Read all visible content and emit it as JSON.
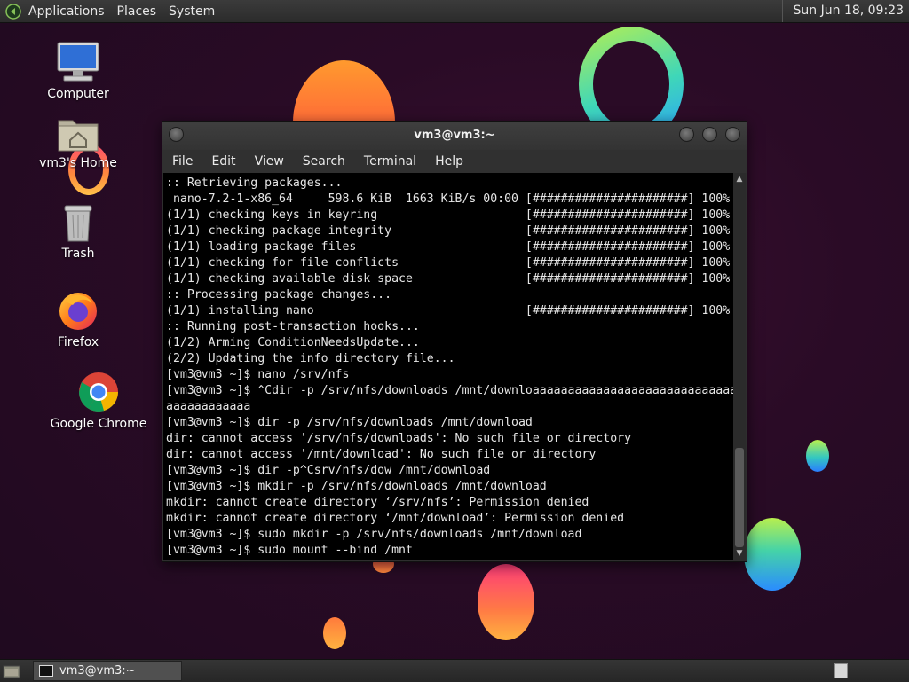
{
  "top_panel": {
    "menus": [
      "Applications",
      "Places",
      "System"
    ],
    "clock": "Sun Jun 18, 09:23"
  },
  "desktop_icons": {
    "computer": "Computer",
    "home": "vm3's Home",
    "trash": "Trash",
    "firefox": "Firefox",
    "chrome": "Google Chrome"
  },
  "terminal": {
    "title": "vm3@vm3:~",
    "menu": [
      "File",
      "Edit",
      "View",
      "Search",
      "Terminal",
      "Help"
    ],
    "lines": [
      ":: Retrieving packages...",
      " nano-7.2-1-x86_64     598.6 KiB  1663 KiB/s 00:00 [######################] 100%",
      "(1/1) checking keys in keyring                     [######################] 100%",
      "(1/1) checking package integrity                   [######################] 100%",
      "(1/1) loading package files                        [######################] 100%",
      "(1/1) checking for file conflicts                  [######################] 100%",
      "(1/1) checking available disk space                [######################] 100%",
      ":: Processing package changes...",
      "(1/1) installing nano                              [######################] 100%",
      ":: Running post-transaction hooks...",
      "(1/2) Arming ConditionNeedsUpdate...",
      "(2/2) Updating the info directory file...",
      "[vm3@vm3 ~]$ nano /srv/nfs",
      "[vm3@vm3 ~]$ ^Cdir -p /srv/nfs/downloads /mnt/downloaaaaaaaaaaaaaaaaaaaaaaaaaaaaa",
      "aaaaaaaaaaaa",
      "[vm3@vm3 ~]$ dir -p /srv/nfs/downloads /mnt/download",
      "dir: cannot access '/srv/nfs/downloads': No such file or directory",
      "dir: cannot access '/mnt/download': No such file or directory",
      "[vm3@vm3 ~]$ dir -p^Csrv/nfs/dow /mnt/download",
      "[vm3@vm3 ~]$ mkdir -p /srv/nfs/downloads /mnt/download",
      "mkdir: cannot create directory ‘/srv/nfs’: Permission denied",
      "mkdir: cannot create directory ‘/mnt/download’: Permission denied",
      "[vm3@vm3 ~]$ sudo mkdir -p /srv/nfs/downloads /mnt/download",
      "[vm3@vm3 ~]$ sudo mount --bind /mnt"
    ]
  },
  "taskbar": {
    "window_button": "vm3@vm3:~"
  },
  "icons": {
    "menu_logo": "gnome-foot-icon",
    "computer": "monitor-icon",
    "home": "home-folder-icon",
    "trash": "trash-icon",
    "firefox": "firefox-icon",
    "chrome": "chrome-icon",
    "show_desktop": "show-desktop-icon",
    "terminal": "terminal-icon"
  }
}
